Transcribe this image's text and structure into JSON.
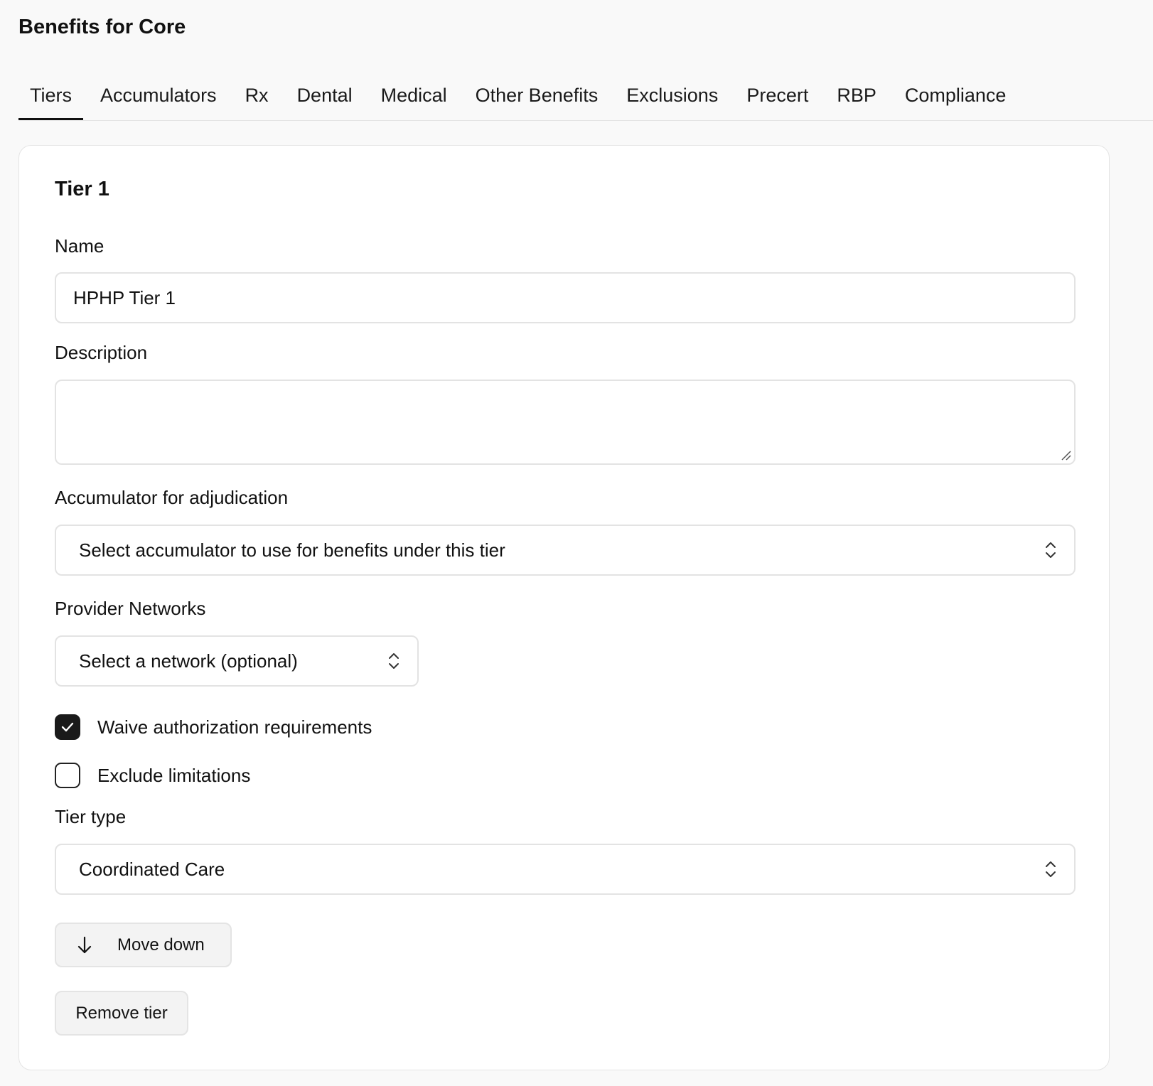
{
  "page": {
    "title": "Benefits for Core"
  },
  "tabs": [
    {
      "label": "Tiers",
      "active": true
    },
    {
      "label": "Accumulators",
      "active": false
    },
    {
      "label": "Rx",
      "active": false
    },
    {
      "label": "Dental",
      "active": false
    },
    {
      "label": "Medical",
      "active": false
    },
    {
      "label": "Other Benefits",
      "active": false
    },
    {
      "label": "Exclusions",
      "active": false
    },
    {
      "label": "Precert",
      "active": false
    },
    {
      "label": "RBP",
      "active": false
    },
    {
      "label": "Compliance",
      "active": false
    }
  ],
  "tier": {
    "title": "Tier 1",
    "name_label": "Name",
    "name_value": "HPHP Tier 1",
    "description_label": "Description",
    "description_value": "",
    "accumulator_label": "Accumulator for adjudication",
    "accumulator_value": "Select accumulator to use for benefits under this tier",
    "networks_label": "Provider Networks",
    "networks_value": "Select a network (optional)",
    "waive_label": "Waive authorization requirements",
    "waive_checked": true,
    "exclude_label": "Exclude limitations",
    "exclude_checked": false,
    "tier_type_label": "Tier type",
    "tier_type_value": "Coordinated Care",
    "move_down_label": "Move down",
    "remove_label": "Remove tier"
  },
  "icons": {
    "select_chevron": "chevron-up-down-icon",
    "move_down": "arrow-down-icon",
    "checkmark": "check-icon",
    "resize": "resize-grip-icon"
  },
  "colors": {
    "background": "#f9f9f9",
    "card": "#ffffff",
    "border": "#e3e3e3",
    "text": "#111111",
    "checkbox_checked": "#1a1a1a",
    "button_bg": "#f3f3f3"
  }
}
